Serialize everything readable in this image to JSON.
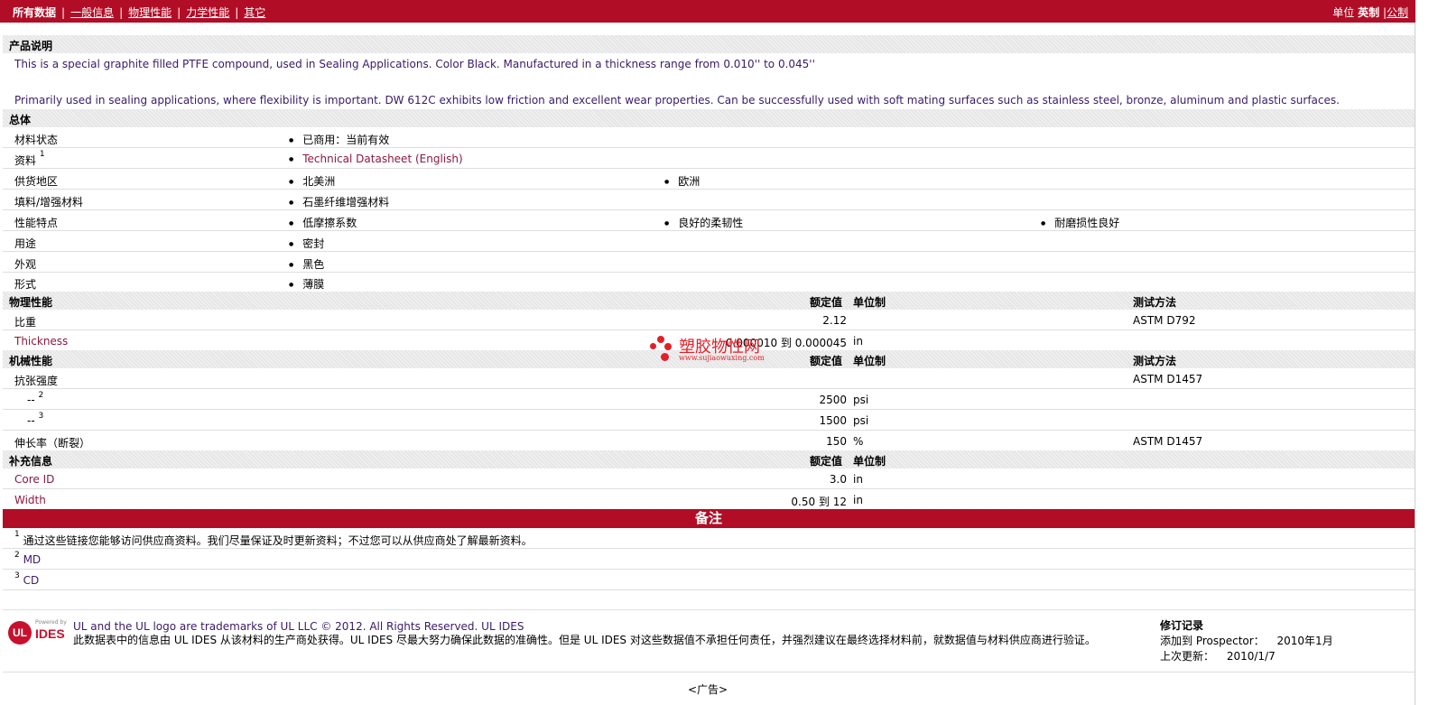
{
  "nav": {
    "current": "所有数据",
    "links": [
      "一般信息",
      "物理性能",
      "力学性能",
      "其它"
    ],
    "sep": "|"
  },
  "units": {
    "label": "单位",
    "current": "英制",
    "sep": "|",
    "other": "公制"
  },
  "product": {
    "heading": "产品说明",
    "line1": "This is a special graphite filled PTFE compound, used in Sealing Applications. Color Black. Manufactured in a thickness range from 0.010'' to 0.045''",
    "line2": "Primarily used in sealing applications, where flexibility is important. DW 612C exhibits low friction and excellent wear properties. Can be successfully used with soft mating surfaces such as stainless steel, bronze, aluminum and plastic surfaces."
  },
  "general": {
    "heading": "总体",
    "rows": [
      {
        "label": "材料状态",
        "values": [
          "已商用：当前有效"
        ]
      },
      {
        "label": "资料",
        "sup": "1",
        "values": [
          "Technical Datasheet (English)"
        ]
      },
      {
        "label": "供货地区",
        "values": [
          "北美洲",
          "欧洲"
        ]
      },
      {
        "label": "填料/增强材料",
        "values": [
          "石墨纤维增强材料"
        ]
      },
      {
        "label": "性能特点",
        "values": [
          "低摩擦系数",
          "良好的柔韧性",
          "耐磨损性良好"
        ]
      },
      {
        "label": "用途",
        "values": [
          "密封"
        ]
      },
      {
        "label": "外观",
        "values": [
          "黑色"
        ]
      },
      {
        "label": "形式",
        "values": [
          "薄膜"
        ]
      }
    ]
  },
  "headers": {
    "nominal": "额定值",
    "unit": "单位制",
    "method": "测试方法"
  },
  "physical": {
    "heading": "物理性能",
    "rows": [
      {
        "label": "比重",
        "value": "2.12",
        "unit": "",
        "method": "ASTM D792"
      },
      {
        "label": "Thickness",
        "value": "0.000010 到 0.000045",
        "unit": "in",
        "method": ""
      }
    ]
  },
  "mechanical": {
    "heading": "机械性能",
    "rows": [
      {
        "label": "抗张强度",
        "value": "",
        "unit": "",
        "method": "ASTM D1457"
      },
      {
        "label": "--",
        "sup": "2",
        "value": "2500",
        "unit": "psi",
        "method": ""
      },
      {
        "label": "--",
        "sup": "3",
        "value": "1500",
        "unit": "psi",
        "method": ""
      },
      {
        "label": "伸长率（断裂）",
        "value": "150",
        "unit": "%",
        "method": "ASTM D1457"
      }
    ]
  },
  "supplemental": {
    "heading": "补充信息",
    "rows": [
      {
        "label": "Core ID",
        "value": "3.0",
        "unit": "in"
      },
      {
        "label": "Width",
        "value": "0.50 到 12",
        "unit": "in"
      }
    ]
  },
  "watermark": {
    "big": "塑胶物性网",
    "small": "www.sujiaowuxing.com"
  },
  "notes": {
    "heading": "备注",
    "items": [
      {
        "sup": "1",
        "text": "通过这些链接您能够访问供应商资料。我们尽量保证及时更新资料；不过您可以从供应商处了解最新资料。"
      },
      {
        "sup": "2",
        "text": "MD"
      },
      {
        "sup": "3",
        "text": "CD"
      }
    ]
  },
  "footer": {
    "logo_ul": "UL",
    "logo_powered": "Powered by",
    "logo_ides": "IDES",
    "line1": "UL and the UL logo are trademarks of UL LLC © 2012. All Rights Reserved. UL IDES",
    "line2": "此数据表中的信息由 UL IDES 从该材料的生产商处获得。UL IDES 尽最大努力确保此数据的准确性。但是 UL IDES 对这些数据值不承担任何责任，并强烈建议在最终选择材料前，就数据值与材料供应商进行验证。",
    "rev_title": "修订记录",
    "added_label": "添加到 Prospector：",
    "added_value": "2010年1月",
    "updated_label": "上次更新：",
    "updated_value": "2010/1/7"
  },
  "ad": "<广告>"
}
